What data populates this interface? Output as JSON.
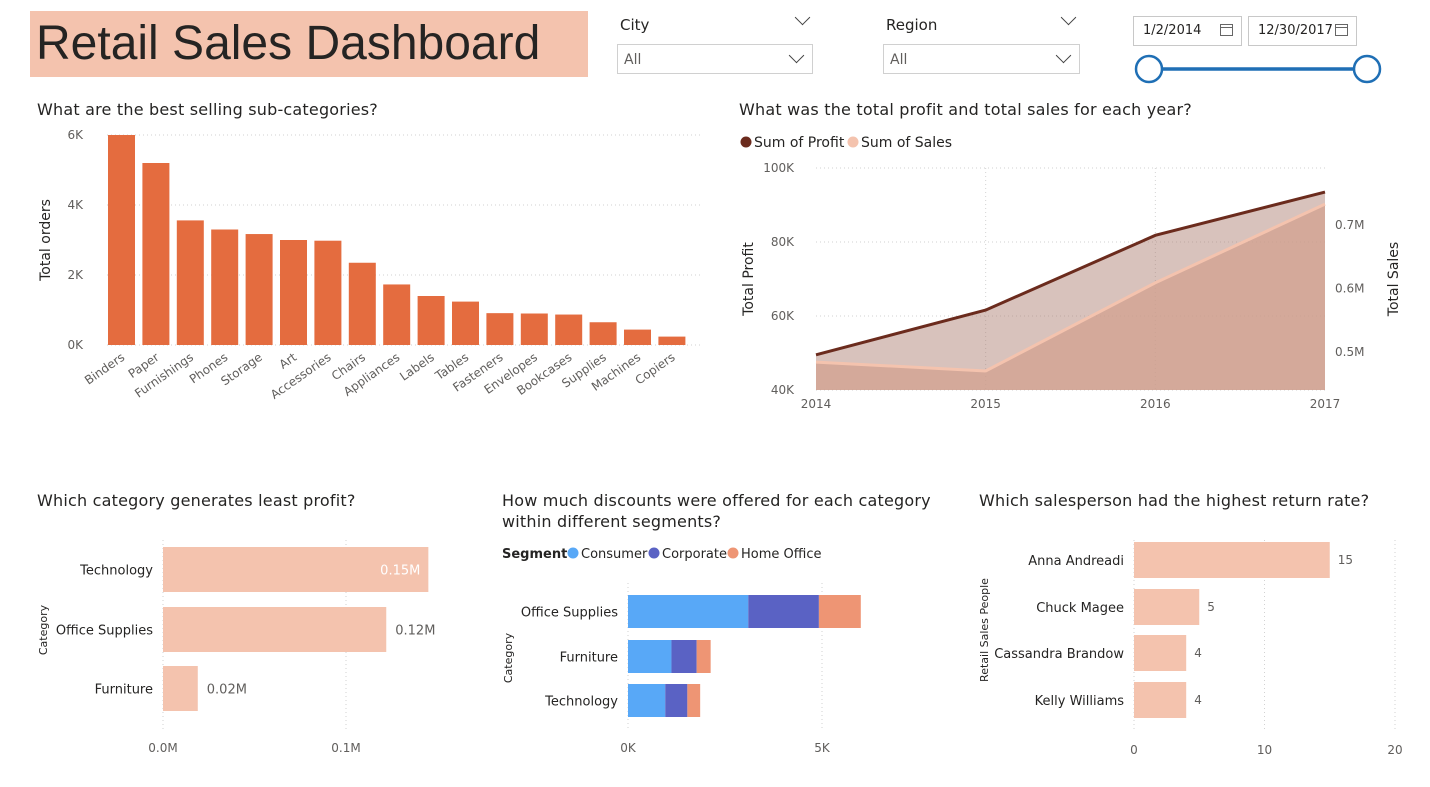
{
  "header": {
    "title": "Retail Sales Dashboard"
  },
  "slicers": {
    "city": {
      "label": "City",
      "value": "All"
    },
    "region": {
      "label": "Region",
      "value": "All"
    },
    "date": {
      "start": "1/2/2014",
      "end": "12/30/2017"
    }
  },
  "colors": {
    "bar_orange": "#e46c3f",
    "peach": "#f4c3ae",
    "profit_line": "#6b2b1d",
    "consumer": "#58a8f7",
    "corporate": "#5a62c4",
    "home_office": "#ee9574",
    "slider": "#1f6fb5"
  },
  "chart_data": [
    {
      "id": "subcategories",
      "type": "bar",
      "title": "What are the best selling sub-categories?",
      "ylabel": "Total orders",
      "categories": [
        "Binders",
        "Paper",
        "Furnishings",
        "Phones",
        "Storage",
        "Art",
        "Accessories",
        "Chairs",
        "Appliances",
        "Labels",
        "Tables",
        "Fasteners",
        "Envelopes",
        "Bookcases",
        "Supplies",
        "Machines",
        "Copiers"
      ],
      "values": [
        6000,
        5200,
        3560,
        3300,
        3170,
        3000,
        2980,
        2350,
        1730,
        1400,
        1240,
        910,
        900,
        870,
        650,
        440,
        240
      ],
      "ylim": [
        0,
        6000
      ],
      "yticks": [
        "0K",
        "2K",
        "4K",
        "6K"
      ]
    },
    {
      "id": "profit_sales",
      "type": "area",
      "title": "What was the total profit and total sales for each year?",
      "legend": [
        "Sum of Profit",
        "Sum of Sales"
      ],
      "x": [
        "2014",
        "2015",
        "2016",
        "2017"
      ],
      "series": [
        {
          "name": "Sum of Profit",
          "axis": "left",
          "values": [
            49500,
            61600,
            81800,
            93500
          ]
        },
        {
          "name": "Sum of Sales",
          "axis": "right",
          "values": [
            484000,
            470000,
            609000,
            733000
          ]
        }
      ],
      "ylabel_left": "Total Profit",
      "ylabel_right": "Total Sales",
      "ylim_left": [
        40000,
        100000
      ],
      "ylim_right": [
        0.44,
        0.79
      ],
      "yticks_left": [
        "40K",
        "60K",
        "80K",
        "100K"
      ],
      "yticks_right": [
        "0.5M",
        "0.6M",
        "0.7M"
      ]
    },
    {
      "id": "category_profit",
      "type": "bar",
      "orientation": "horizontal",
      "title": "Which category generates least profit?",
      "ylabel": "Category",
      "categories": [
        "Technology",
        "Office Supplies",
        "Furniture"
      ],
      "values": [
        0.145,
        0.122,
        0.019
      ],
      "value_labels": [
        "0.15M",
        "0.12M",
        "0.02M"
      ],
      "xticks": [
        "0.0M",
        "0.1M"
      ]
    },
    {
      "id": "discounts",
      "type": "bar",
      "orientation": "horizontal",
      "stacked": true,
      "title": "How much discounts were offered for each category within different segments?",
      "title_lines": [
        "How much discounts were offered for each category",
        "within different segments?"
      ],
      "legend_title": "Segment",
      "ylabel": "Category",
      "categories": [
        "Office Supplies",
        "Furniture",
        "Technology"
      ],
      "series": [
        {
          "name": "Consumer",
          "values": [
            3100,
            1120,
            960
          ]
        },
        {
          "name": "Corporate",
          "values": [
            1820,
            650,
            570
          ]
        },
        {
          "name": "Home Office",
          "values": [
            1080,
            360,
            330
          ]
        }
      ],
      "xticks": [
        "0K",
        "5K"
      ]
    },
    {
      "id": "returns",
      "type": "bar",
      "orientation": "horizontal",
      "title": "Which salesperson had the highest return rate?",
      "ylabel": "Retail Sales People",
      "categories": [
        "Anna Andreadi",
        "Chuck Magee",
        "Cassandra Brandow",
        "Kelly Williams"
      ],
      "values": [
        15,
        5,
        4,
        4
      ],
      "value_labels": [
        "15",
        "5",
        "4",
        "4"
      ],
      "xticks": [
        "0",
        "10",
        "20"
      ],
      "xlim": [
        0,
        20
      ]
    }
  ]
}
